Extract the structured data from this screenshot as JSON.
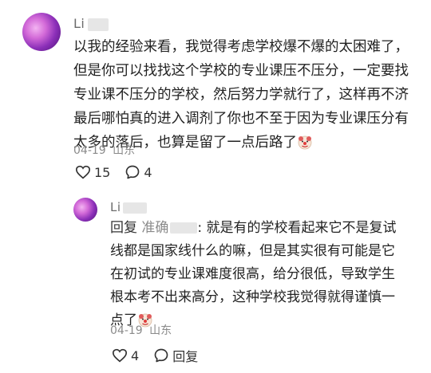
{
  "comment": {
    "username": "Li",
    "lines": [
      "以我的经验来看，我觉得考虑学校爆不爆的太困难了，",
      "但是你可以找找这个学校的专业课压不压分，一定要找",
      "专业课不压分的学校，然后努力学就行了，这样再不济",
      "最后哪怕真的进入调剂了你也不至于因为专业课压分有",
      "太多的落后，也算是留了一点后路了"
    ],
    "date": "04-19",
    "location": "山东",
    "likes": "15",
    "replies": "4",
    "emoji_icon": "clown-face-icon"
  },
  "reply": {
    "username": "Li",
    "prefix": "回复",
    "reply_to": "准确",
    "first_line_rest": ": 就是有的学校看起来它不是复试",
    "lines": [
      "线都是国家线什么的嘛，但是其实很有可能是它",
      "在初试的专业课难度很高，给分很低，导致学生",
      "根本考不出来高分，这种学校我觉得就得谨慎一",
      "点了"
    ],
    "date": "04-19",
    "location": "山东",
    "likes": "4",
    "reply_label": "回复",
    "emoji_icon": "clown-face-icon"
  },
  "icons": {
    "like": "heart-outline-icon",
    "comment": "speech-bubble-icon"
  }
}
